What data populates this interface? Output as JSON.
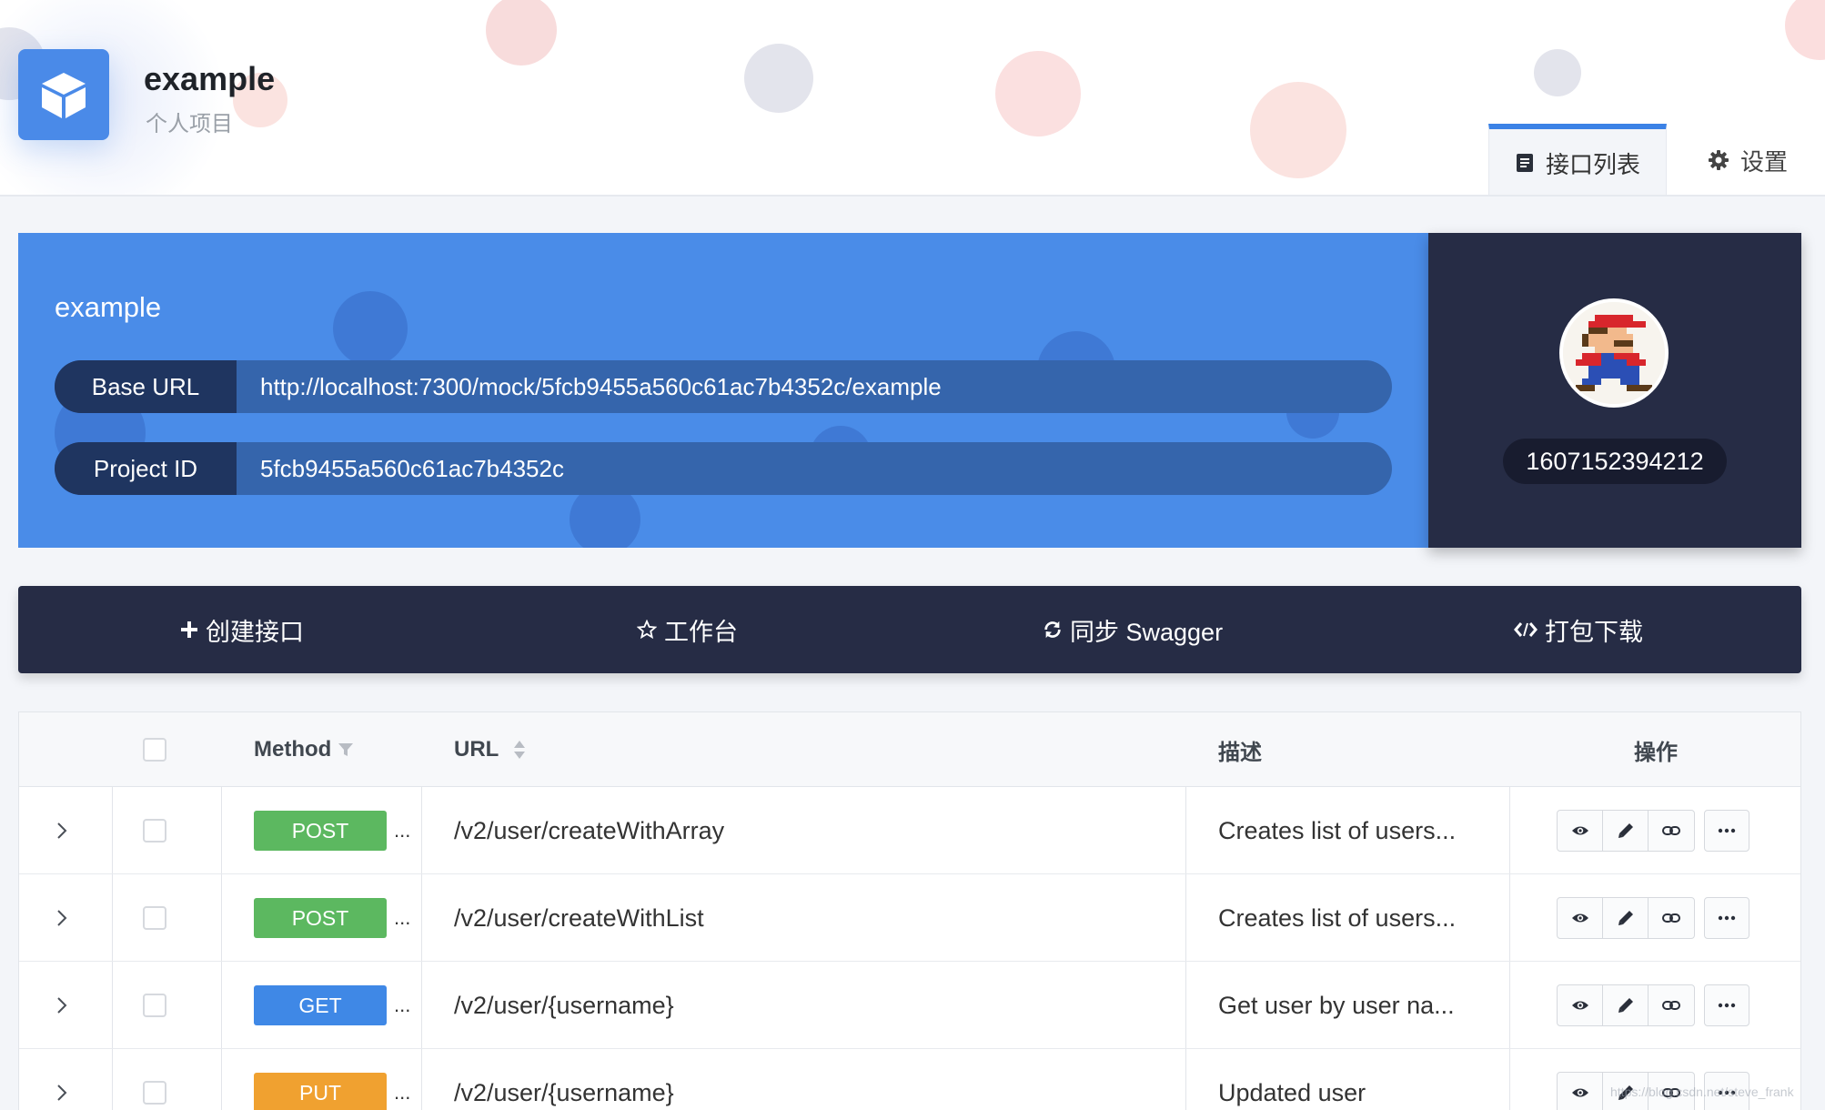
{
  "header": {
    "project_name": "example",
    "project_type": "个人项目",
    "tabs": [
      {
        "label": "接口列表",
        "icon": "document-icon",
        "active": true
      },
      {
        "label": "设置",
        "icon": "gear-icon",
        "active": false
      }
    ]
  },
  "info": {
    "title": "example",
    "base_url_label": "Base URL",
    "base_url": "http://localhost:7300/mock/5fcb9455a560c61ac7b4352c/example",
    "project_id_label": "Project ID",
    "project_id": "5fcb9455a560c61ac7b4352c"
  },
  "user": {
    "id": "1607152394212",
    "avatar": "pixel-plumber-avatar"
  },
  "actions": [
    {
      "label": "创建接口",
      "icon": "plus-icon"
    },
    {
      "label": "工作台",
      "icon": "star-icon"
    },
    {
      "label": "同步 Swagger",
      "icon": "sync-icon"
    },
    {
      "label": "打包下载",
      "icon": "code-icon"
    }
  ],
  "table": {
    "headers": {
      "method": "Method",
      "url": "URL",
      "desc": "描述",
      "ops": "操作"
    },
    "rows": [
      {
        "method": "POST",
        "url": "/v2/user/createWithArray",
        "desc": "Creates list of users..."
      },
      {
        "method": "POST",
        "url": "/v2/user/createWithList",
        "desc": "Creates list of users..."
      },
      {
        "method": "GET",
        "url": "/v2/user/{username}",
        "desc": "Get user by user na..."
      },
      {
        "method": "PUT",
        "url": "/v2/user/{username}",
        "desc": "Updated user"
      }
    ],
    "ellipsis": "...",
    "method_colors": {
      "POST": "#5cb860",
      "GET": "#3f88e6",
      "PUT": "#f0a130"
    }
  },
  "watermark": "https://blog.csdn.net/steve_frank"
}
